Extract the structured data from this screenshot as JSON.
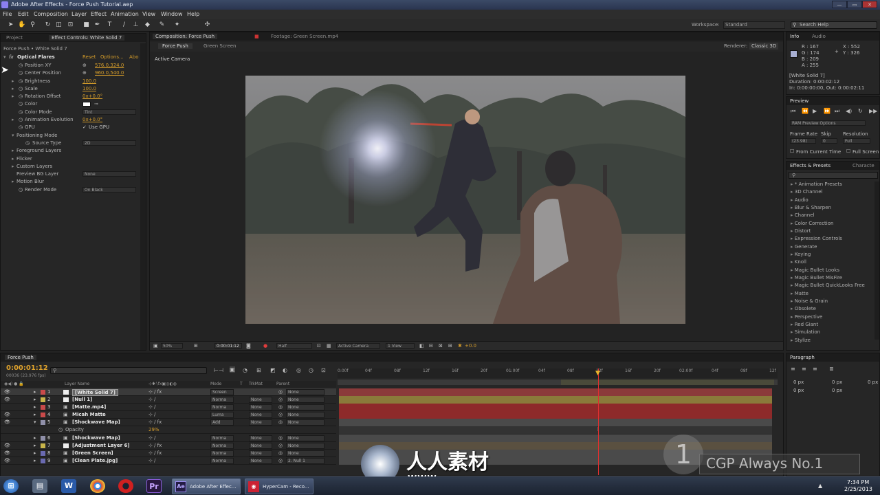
{
  "window": {
    "title": "Adobe After Effects - Force Push Tutorial.aep",
    "min": "—",
    "max": "▭",
    "close": "✕"
  },
  "menu": [
    "File",
    "Edit",
    "Composition",
    "Layer",
    "Effect",
    "Animation",
    "View",
    "Window",
    "Help"
  ],
  "toolbar": {
    "workspace_label": "Workspace:",
    "workspace_value": "Standard",
    "search_placeholder": "Search Help"
  },
  "project_panel": {
    "tab_project": "Project",
    "tab_effect_controls": "Effect Controls: White Solid 7",
    "breadcrumb": "Force Push • White Solid 7"
  },
  "effect": {
    "name": "Optical Flares",
    "reset": "Reset",
    "options": "Options...",
    "about": "Abo",
    "props": [
      {
        "name": "Position XY",
        "value": "576.0,324.0"
      },
      {
        "name": "Center Position",
        "value": "960.0,540.0"
      },
      {
        "name": "Brightness",
        "value": "100.0"
      },
      {
        "name": "Scale",
        "value": "100.0"
      },
      {
        "name": "Rotation Offset",
        "value": "0x+0.0°"
      },
      {
        "name": "Color",
        "value": ""
      },
      {
        "name": "Color Mode",
        "value": "Tint"
      },
      {
        "name": "Animation Evolution",
        "value": "0x+0.0°"
      },
      {
        "name": "GPU",
        "value": "Use GPU"
      },
      {
        "name": "Positioning Mode",
        "value": ""
      },
      {
        "name": "Source Type",
        "value": "2D"
      },
      {
        "name": "Foreground Layers",
        "value": ""
      },
      {
        "name": "Flicker",
        "value": ""
      },
      {
        "name": "Custom Layers",
        "value": ""
      },
      {
        "name": "Preview BG Layer",
        "value": "None"
      },
      {
        "name": "Motion Blur",
        "value": ""
      },
      {
        "name": "Render Mode",
        "value": "On Black"
      }
    ]
  },
  "comp_panel": {
    "tab_comp": "Composition: Force Push",
    "tab_footage": "Footage: Green Screen.mp4",
    "subtab1": "Force Push",
    "subtab2": "Green Screen",
    "renderer_label": "Renderer:",
    "renderer_value": "Classic 3D",
    "camera_label": "Active Camera",
    "zoom": "50%",
    "timecode": "0:00:01:12",
    "resolution": "Half",
    "camera": "Active Camera",
    "views": "1 View",
    "exposure": "+0.0"
  },
  "info_panel": {
    "tab_info": "Info",
    "tab_audio": "Audio",
    "r": "R : 167",
    "g": "G : 174",
    "b": "B : 209",
    "a": "A : 255",
    "x": "X : 552",
    "y": "Y : 326",
    "layer": "[White Solid 7]",
    "duration": "Duration: 0:00:02:12",
    "in_out": "In: 0:00:00:00, Out: 0:00:02:11",
    "swatch_color": "#a7aed1"
  },
  "preview_panel": {
    "tab": "Preview",
    "ram_options": "RAM Preview Options",
    "frame_rate_label": "Frame Rate",
    "skip_label": "Skip",
    "resolution_label": "Resolution",
    "frame_rate": "(23.98)",
    "skip": "0",
    "resolution": "Full",
    "from_current": "From Current Time",
    "full_screen": "Full Screen"
  },
  "effects_panel": {
    "tab": "Effects & Presets",
    "tab2": "Characte",
    "items": [
      "* Animation Presets",
      "3D Channel",
      "Audio",
      "Blur & Sharpen",
      "Channel",
      "Color Correction",
      "Distort",
      "Expression Controls",
      "Generate",
      "Keying",
      "Knoll",
      "Magic Bullet Looks",
      "Magic Bullet MisFire",
      "Magic Bullet QuickLooks Free",
      "Matte",
      "Noise & Grain",
      "Obsolete",
      "Perspective",
      "Red Giant",
      "Simulation",
      "Stylize"
    ]
  },
  "paragraph_panel": {
    "tab": "Paragraph",
    "px1": "0 px",
    "px2": "0 px",
    "px3": "0 px",
    "px4": "0 px",
    "px5": "0 px"
  },
  "timeline": {
    "tab": "Force Push",
    "timecode": "0:00:01:12",
    "fps": "00036 (23.976 fps)",
    "col_layer": "Layer Name",
    "col_mode": "Mode",
    "col_t": "T",
    "col_trkmat": "TrkMat",
    "col_parent": "Parent",
    "ruler": [
      "0:00f",
      "04f",
      "08f",
      "12f",
      "16f",
      "20f",
      "01:00f",
      "04f",
      "08f",
      "12f",
      "16f",
      "20f",
      "02:00f",
      "04f",
      "08f",
      "12f"
    ],
    "layers": [
      {
        "num": "1",
        "name": "[White Solid 7]",
        "mode": "Screen",
        "trk": "",
        "parent": "None",
        "color": "#c94a4a",
        "bar": "#8b3a3a"
      },
      {
        "num": "2",
        "name": "[Null 1]",
        "mode": "Norma",
        "trk": "None",
        "parent": "None",
        "color": "#c8b44a",
        "bar": "#8a7a3a"
      },
      {
        "num": "3",
        "name": "[Matte.mp4]",
        "mode": "Norma",
        "trk": "None",
        "parent": "None",
        "color": "#c94a4a",
        "bar": "#8e2a2a"
      },
      {
        "num": "4",
        "name": "Micah Matte",
        "mode": "Luma",
        "trk": "None",
        "parent": "None",
        "color": "#c94a4a",
        "bar": "#8e2a2a"
      },
      {
        "num": "5",
        "name": "[Shockwave Map]",
        "mode": "Add",
        "trk": "None",
        "parent": "None",
        "color": "#8f8fa8",
        "bar": "#4a4a4a"
      },
      {
        "num": "6",
        "name": "[Shockwave Map]",
        "mode": "Norma",
        "trk": "None",
        "parent": "None",
        "color": "#8f8fa8",
        "bar": "#4a4a4a"
      },
      {
        "num": "7",
        "name": "[Adjustment Layer 6]",
        "mode": "Norma",
        "trk": "None",
        "parent": "None",
        "color": "#c8b44a",
        "bar": "#5a5040"
      },
      {
        "num": "8",
        "name": "[Green Screen]",
        "mode": "Norma",
        "trk": "None",
        "parent": "None",
        "color": "#6a6ab0",
        "bar": "#4a4a4a"
      },
      {
        "num": "9",
        "name": "[Clean Plate.jpg]",
        "mode": "Norma",
        "trk": "None",
        "parent": "2. Null 1",
        "color": "#6a6ab0",
        "bar": "#4a4a4a"
      }
    ],
    "opacity_label": "Opacity",
    "opacity_value": "29%"
  },
  "watermark": {
    "brand": "人人素材",
    "url": "WWW.rr-sc.com",
    "tagline": "CGP Always No.1"
  },
  "taskbar": {
    "btn1": "Adobe After Effec...",
    "btn2": "HyperCam - Reco...",
    "time": "7:34 PM",
    "date": "2/25/2013"
  }
}
